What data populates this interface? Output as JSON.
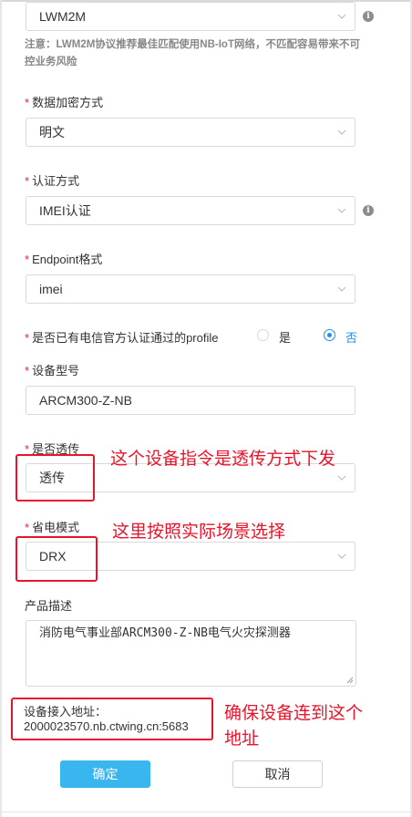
{
  "form": {
    "protocol": {
      "value": "LWM2M"
    },
    "note": "注意：LWM2M协议推荐最佳匹配使用NB-IoT网络，不匹配容易带来不可控业务风险",
    "encryption": {
      "label": "数据加密方式",
      "value": "明文"
    },
    "auth": {
      "label": "认证方式",
      "value": "IMEI认证"
    },
    "endpoint": {
      "label": "Endpoint格式",
      "value": "imei"
    },
    "profile": {
      "label": "是否已有电信官方认证通过的profile",
      "option_yes": "是",
      "option_no": "否",
      "selected": "否"
    },
    "model": {
      "label": "设备型号",
      "value": "ARCM300-Z-NB"
    },
    "passthrough": {
      "label": "是否透传",
      "value": "透传"
    },
    "power": {
      "label": "省电模式",
      "value": "DRX"
    },
    "description": {
      "label": "产品描述",
      "value": "消防电气事业部ARCM300-Z-NB电气火灾探测器"
    },
    "address": {
      "label": "设备接入地址：",
      "value": "2000023570.nb.ctwing.cn:5683"
    }
  },
  "buttons": {
    "confirm": "确定",
    "cancel": "取消"
  },
  "annotations": {
    "passthrough": "这个设备指令是透传方式下发",
    "power": "这里按照实际场景选择",
    "address_line1": "确保设备连到这个",
    "address_line2": "地址"
  },
  "colors": {
    "annotation": "#e8142b",
    "primary": "#3ab6ee",
    "required": "#f5222d"
  }
}
